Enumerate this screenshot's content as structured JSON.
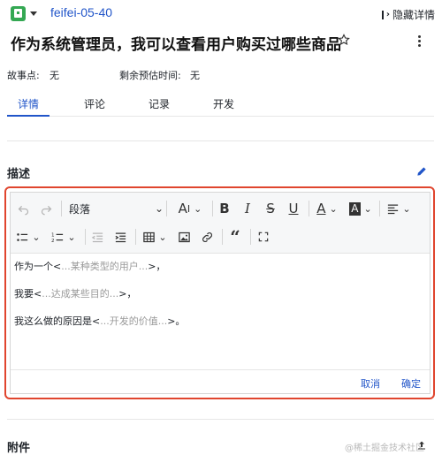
{
  "header": {
    "issue_key": "feifei-05-40",
    "hide_details_label": "隐藏详情"
  },
  "story": {
    "title": "作为系统管理员，我可以查看用户购买过哪些商品",
    "story_points_label": "故事点:",
    "story_points_value": "无",
    "remaining_label": "剩余预估时间:",
    "remaining_value": "无"
  },
  "tabs": [
    {
      "label": "详情",
      "active": true
    },
    {
      "label": "评论",
      "active": false
    },
    {
      "label": "记录",
      "active": false
    },
    {
      "label": "开发",
      "active": false
    }
  ],
  "description": {
    "section_title": "描述",
    "toolbar": {
      "paragraph_select": "段落"
    },
    "lines": [
      {
        "prefix": "作为一个<",
        "placeholder": "...某种类型的用户...",
        "suffix": ">，"
      },
      {
        "prefix": "我要<",
        "placeholder": "...达成某些目的...",
        "suffix": ">，"
      },
      {
        "prefix": "我这么做的原因是<",
        "placeholder": "...开发的价值...",
        "suffix": ">。"
      }
    ],
    "cancel_label": "取消",
    "confirm_label": "确定"
  },
  "attachments": {
    "section_title": "附件"
  },
  "watermark": "@稀土掘金技术社区",
  "colors": {
    "accent": "#2155c9",
    "highlight_border": "#e0452e",
    "type_icon": "#34a853"
  }
}
